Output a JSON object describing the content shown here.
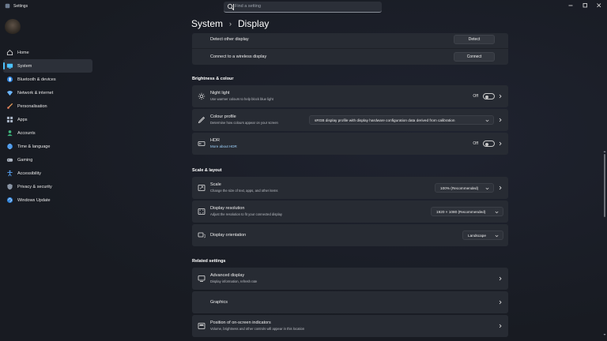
{
  "window": {
    "title": "Settings"
  },
  "search": {
    "placeholder": "Find a setting"
  },
  "sidebar": {
    "items": [
      {
        "label": "Home",
        "icon": "home-icon"
      },
      {
        "label": "System",
        "icon": "system-icon",
        "active": true
      },
      {
        "label": "Bluetooth & devices",
        "icon": "bluetooth-icon"
      },
      {
        "label": "Network & internet",
        "icon": "network-icon"
      },
      {
        "label": "Personalisation",
        "icon": "brush-icon"
      },
      {
        "label": "Apps",
        "icon": "apps-icon"
      },
      {
        "label": "Accounts",
        "icon": "accounts-icon"
      },
      {
        "label": "Time & language",
        "icon": "globe-icon"
      },
      {
        "label": "Gaming",
        "icon": "gaming-icon"
      },
      {
        "label": "Accessibility",
        "icon": "accessibility-icon"
      },
      {
        "label": "Privacy & security",
        "icon": "shield-icon"
      },
      {
        "label": "Windows Update",
        "icon": "update-icon"
      }
    ]
  },
  "breadcrumb": {
    "parent": "System",
    "separator": "›",
    "current": "Display"
  },
  "top_rows": {
    "detect": {
      "title": "Detect other display",
      "button": "Detect"
    },
    "wireless": {
      "title": "Connect to a wireless display",
      "button": "Connect"
    }
  },
  "brightness": {
    "heading": "Brightness & colour",
    "night_light": {
      "title": "Night light",
      "subtitle": "Use warmer colours to help block blue light",
      "state": "Off"
    },
    "colour_profile": {
      "title": "Colour profile",
      "subtitle": "Determine how colours appear on your screen",
      "value": "sRGB display profile with display hardware configuration data derived from calibration"
    },
    "hdr": {
      "title": "HDR",
      "link": "More about HDR",
      "state": "Off"
    }
  },
  "scale_layout": {
    "heading": "Scale & layout",
    "scale": {
      "title": "Scale",
      "subtitle": "Change the size of text, apps, and other items",
      "value": "100% (Recommended)"
    },
    "resolution": {
      "title": "Display resolution",
      "subtitle": "Adjust the resolution to fit your connected display",
      "value": "1920 × 1080 (Recommended)"
    },
    "orientation": {
      "title": "Display orientation",
      "value": "Landscape"
    }
  },
  "related": {
    "heading": "Related settings",
    "advanced": {
      "title": "Advanced display",
      "subtitle": "Display information, refresh rate"
    },
    "graphics": {
      "title": "Graphics"
    },
    "indicators": {
      "title": "Position of on-screen indicators",
      "subtitle": "Volume, brightness and other controls will appear in this location"
    }
  },
  "colors": {
    "accent": "#4cc2ff",
    "card": "#272b33",
    "background": "#1c1f26"
  }
}
